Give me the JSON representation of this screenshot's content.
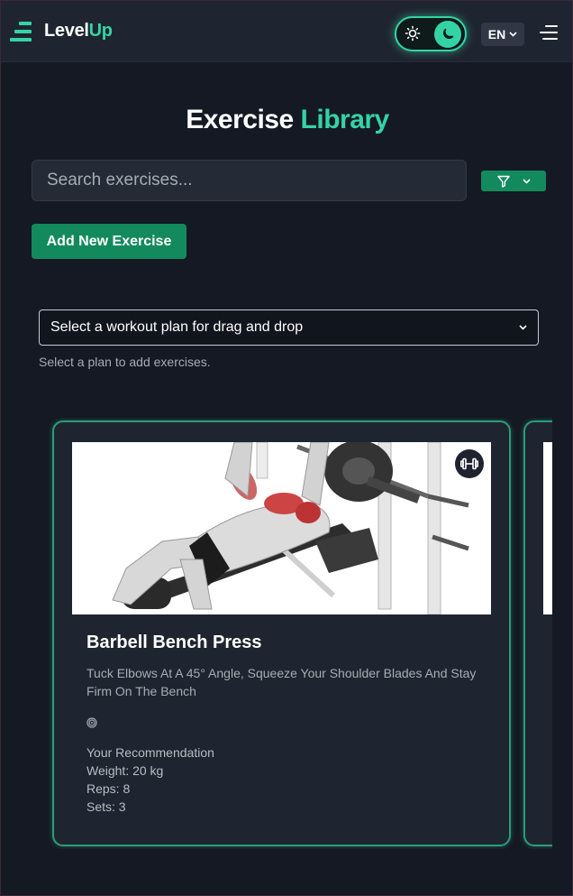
{
  "brand": {
    "name_part1": "Level",
    "name_part2": "Up",
    "accent": "#34d3a6"
  },
  "header": {
    "theme_toggle": {
      "light_icon": "sun-icon",
      "dark_icon": "moon-icon",
      "active": "dark"
    },
    "language": "EN",
    "menu_icon": "hamburger-menu-icon"
  },
  "page": {
    "title_part1": "Exercise",
    "title_part2": "Library"
  },
  "search": {
    "placeholder": "Search exercises...",
    "value": ""
  },
  "filter": {
    "icon": "filter-icon",
    "dropdown_icon": "chevron-down-icon"
  },
  "add_button": "Add New Exercise",
  "plan_select": {
    "selected": "Select a workout plan for drag and drop",
    "hint": "Select a plan to add exercises."
  },
  "exercises": [
    {
      "name": "Barbell Bench Press",
      "description": "Tuck Elbows At A 45° Angle, Squeeze Your Shoulder Blades And Stay Firm On The Bench",
      "badge_icon": "dumbbell-icon",
      "target_icon": "target-icon",
      "recommendation_heading": "Your Recommendation",
      "weight": "Weight: 20 kg",
      "reps": "Reps: 8",
      "sets": "Sets: 3"
    }
  ]
}
